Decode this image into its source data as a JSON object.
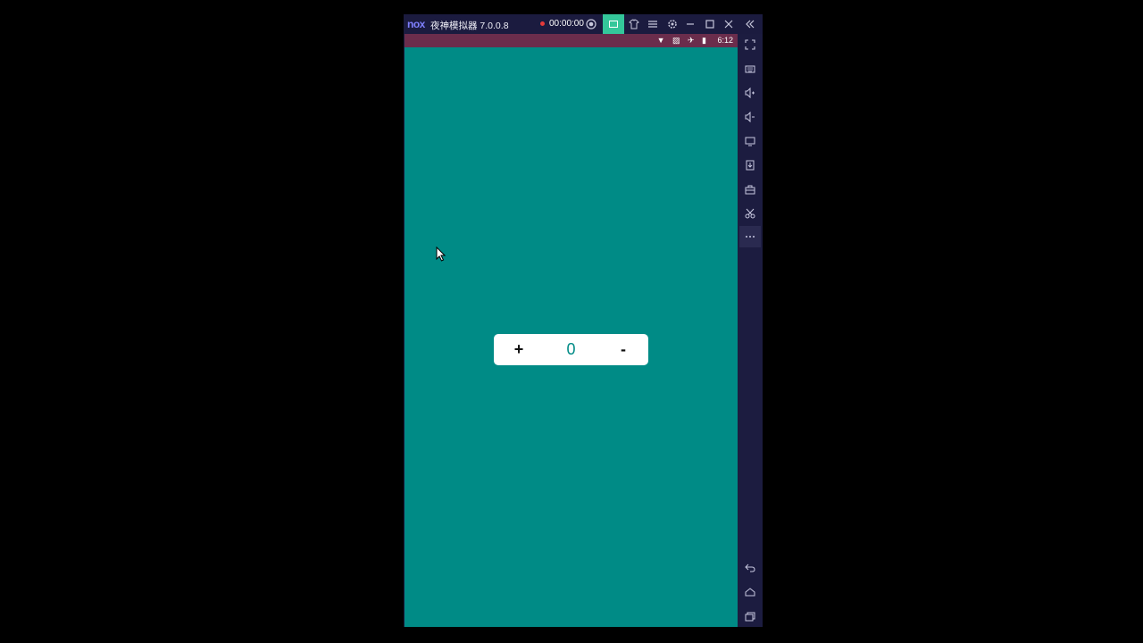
{
  "window": {
    "logo": "nox",
    "title": "夜神模拟器 7.0.0.8",
    "record_time": "00:00:00",
    "icons": [
      "record-stop-icon",
      "multi-window-icon",
      "shirt-icon",
      "menu-icon",
      "settings-icon",
      "minimize-icon",
      "maximize-icon",
      "close-icon",
      "collapse-icon"
    ]
  },
  "statusbar": {
    "icons": "▼ ▨ ✈ ▮",
    "time": "6:12"
  },
  "app": {
    "background": "#008b86",
    "plus_label": "+",
    "count": "0",
    "minus_label": "-"
  },
  "sidebar": {
    "items": [
      {
        "icon": "fullscreen-icon",
        "glyph": "⤢"
      },
      {
        "icon": "keyboard-icon",
        "glyph": "⌨"
      },
      {
        "icon": "volume-up-icon",
        "glyph": "🔊"
      },
      {
        "icon": "volume-down-icon",
        "glyph": "🔉"
      },
      {
        "icon": "screen-icon",
        "glyph": "▭"
      },
      {
        "icon": "apk-install-icon",
        "glyph": "⊞"
      },
      {
        "icon": "toolbox-icon",
        "glyph": "⌸"
      },
      {
        "icon": "scissors-icon",
        "glyph": "✂"
      },
      {
        "icon": "more-icon",
        "glyph": "⋯"
      },
      {
        "icon": "back-icon",
        "glyph": "↩"
      },
      {
        "icon": "home-icon",
        "glyph": "⌂"
      },
      {
        "icon": "recent-apps-icon",
        "glyph": "❐"
      }
    ]
  }
}
